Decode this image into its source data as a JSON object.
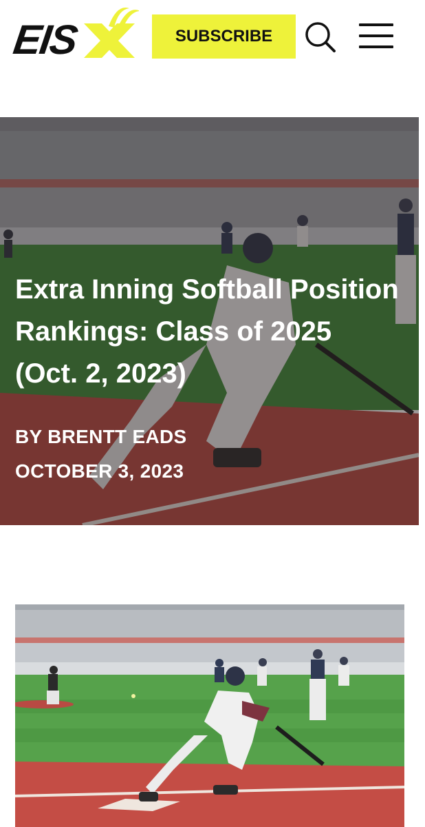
{
  "header": {
    "logo_text": "EIS",
    "subscribe_label": "SUBSCRIBE",
    "search_icon": "search-icon",
    "menu_icon": "hamburger-menu-icon"
  },
  "colors": {
    "accent": "#eef23a",
    "text_dark": "#111111",
    "hero_text": "#ffffff",
    "field_green": "#3f8a3a",
    "infield_red": "#b94a43"
  },
  "articles": [
    {
      "title": "Extra Inning Softball Position Rankings: Class of 2025 (Oct. 2, 2023)",
      "author": "BY BRENTT EADS",
      "date": "OCTOBER 3, 2023"
    }
  ]
}
